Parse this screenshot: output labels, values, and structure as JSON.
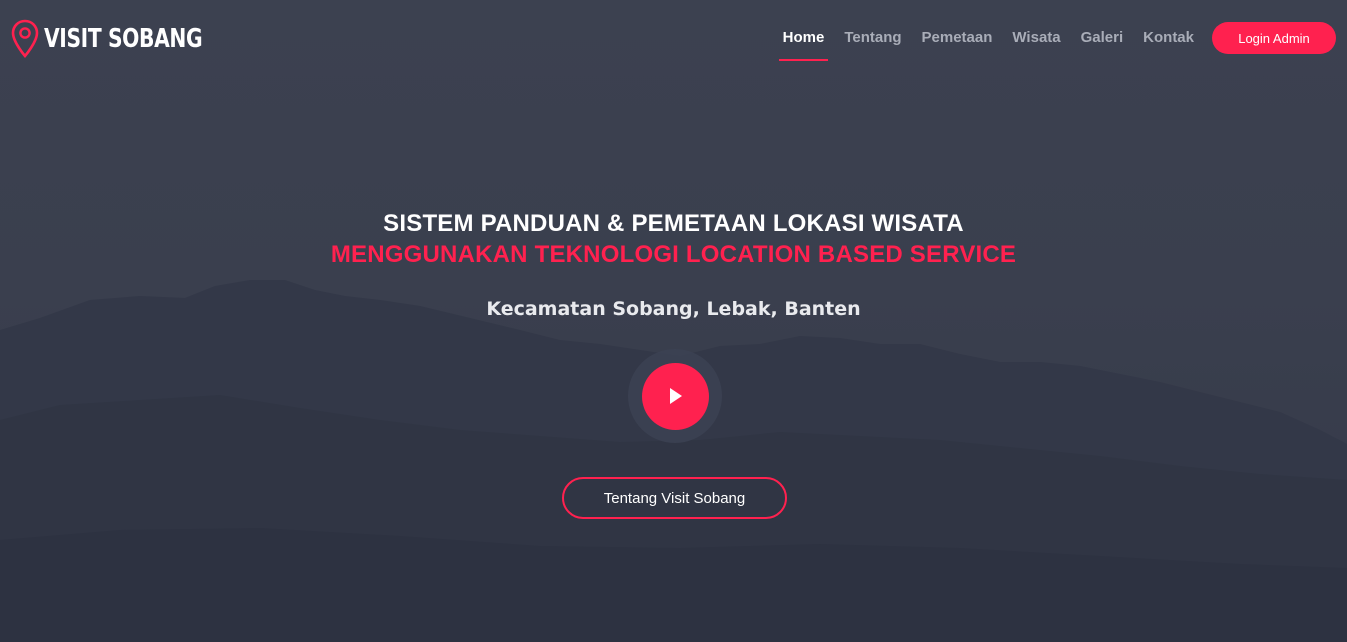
{
  "brand": {
    "name": "VISIT SOBANG",
    "icon": "map-pin-icon"
  },
  "nav": {
    "items": [
      {
        "label": "Home",
        "active": true
      },
      {
        "label": "Tentang",
        "active": false
      },
      {
        "label": "Pemetaan",
        "active": false
      },
      {
        "label": "Wisata",
        "active": false
      },
      {
        "label": "Galeri",
        "active": false
      },
      {
        "label": "Kontak",
        "active": false
      }
    ],
    "login_label": "Login Admin"
  },
  "hero": {
    "title_line1": "SISTEM PANDUAN & PEMETAAN LOKASI WISATA",
    "title_line2": "MENGGUNAKAN TEKNOLOGI LOCATION BASED SERVICE",
    "subtitle": "Kecamatan Sobang, Lebak, Banten",
    "play_icon": "play-icon",
    "cta_label": "Tentang Visit Sobang"
  },
  "colors": {
    "accent": "#ff214f",
    "background": "#3a3f4e",
    "nav_inactive": "#a9adb8"
  }
}
